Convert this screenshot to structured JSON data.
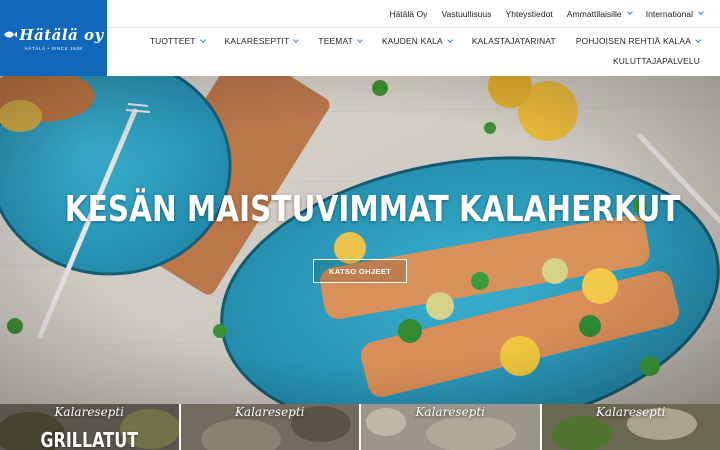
{
  "brand": {
    "logo_text": "Hätälä oy",
    "logo_sub": "HÄTÄLÄ • SINCE 1938",
    "color": "#1268b8"
  },
  "top_links": [
    {
      "label": "Hätälä Oy",
      "dropdown": false
    },
    {
      "label": "Vastuullisuus",
      "dropdown": false
    },
    {
      "label": "Yhteystiedot",
      "dropdown": false
    },
    {
      "label": "Ammattilaisille",
      "dropdown": true
    },
    {
      "label": "International",
      "dropdown": true
    }
  ],
  "main_nav": [
    {
      "label": "TUOTTEET",
      "dropdown": true
    },
    {
      "label": "KALARESEPTIT",
      "dropdown": true
    },
    {
      "label": "TEEMAT",
      "dropdown": true
    },
    {
      "label": "KAUDEN KALA",
      "dropdown": true
    },
    {
      "label": "KALASTAJATARINAT",
      "dropdown": false
    },
    {
      "label": "POHJOISEN REHTIÄ KALAA",
      "dropdown": true
    }
  ],
  "nav_row2": {
    "label": "KULUTTAJAPALVELU"
  },
  "hero": {
    "title": "KESÄN MAISTUVIMMAT KALAHERKUT",
    "button": "KATSO OHJEET"
  },
  "cards": [
    {
      "kicker": "Kalaresepti",
      "title": "GRILLATUT"
    },
    {
      "kicker": "Kalaresepti",
      "title": ""
    },
    {
      "kicker": "Kalaresepti",
      "title": ""
    },
    {
      "kicker": "Kalaresepti",
      "title": ""
    }
  ],
  "colors": {
    "accent_chevron": "#1a8ad0",
    "plate_blue": "#2fa3c4"
  }
}
